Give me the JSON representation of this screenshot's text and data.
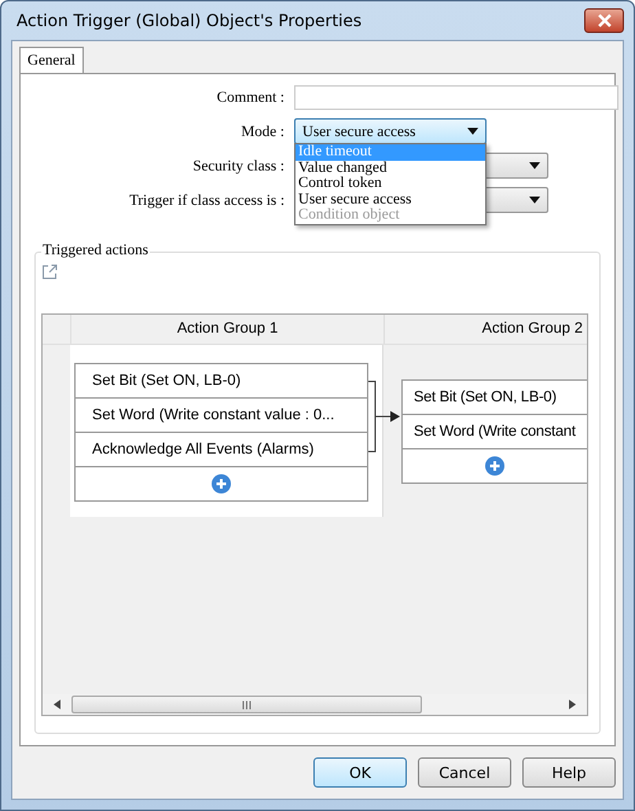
{
  "window": {
    "title": "Action Trigger (Global) Object's Properties"
  },
  "tabs": [
    {
      "label": "General",
      "selected": true
    }
  ],
  "form": {
    "comment": {
      "label": "Comment :"
    },
    "mode": {
      "label": "Mode :",
      "value": "User secure access",
      "options": [
        {
          "label": "Idle timeout",
          "highlighted": true,
          "disabled": false
        },
        {
          "label": "Value changed",
          "highlighted": false,
          "disabled": false
        },
        {
          "label": "Control token",
          "highlighted": false,
          "disabled": false
        },
        {
          "label": "User secure access",
          "highlighted": false,
          "disabled": false
        },
        {
          "label": "Condition object",
          "highlighted": false,
          "disabled": true
        }
      ]
    },
    "security_class": {
      "label": "Security class :"
    },
    "trigger_access": {
      "label": "Trigger if class access is :"
    }
  },
  "triggered_actions": {
    "title": "Triggered actions",
    "groups": [
      {
        "title": "Action Group 1",
        "actions": [
          "Set Bit (Set ON, LB-0)",
          "Set Word (Write constant value : 0...",
          "Acknowledge All Events (Alarms)"
        ]
      },
      {
        "title": "Action Group 2",
        "actions": [
          "Set Bit (Set ON, LB-0)",
          "Set Word (Write constant"
        ]
      }
    ]
  },
  "buttons": [
    {
      "label": "OK",
      "default": true
    },
    {
      "label": "Cancel",
      "default": false
    },
    {
      "label": "Help",
      "default": false
    }
  ]
}
